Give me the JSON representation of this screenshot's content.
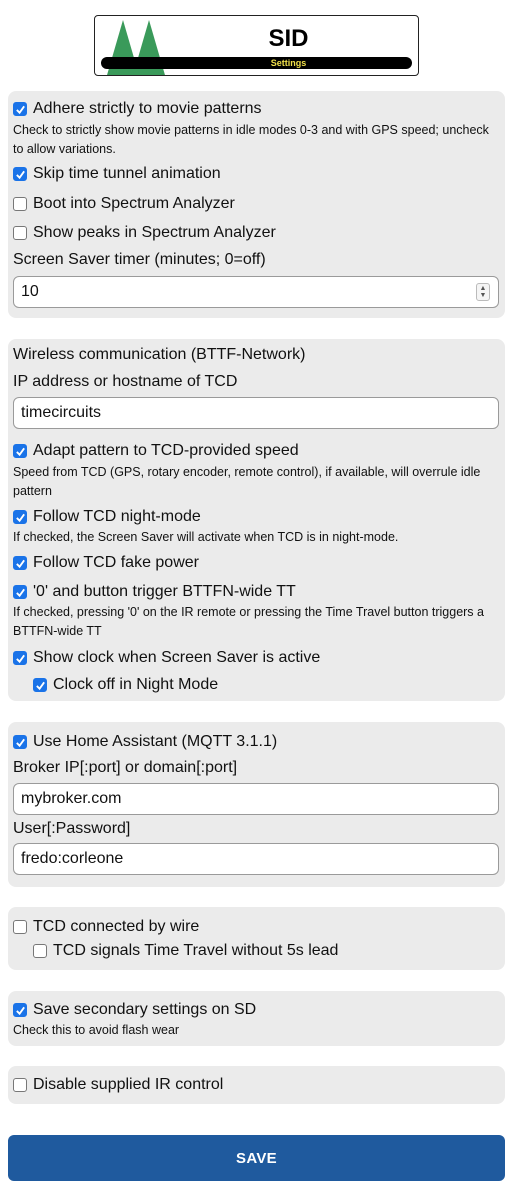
{
  "header": {
    "title": "SID",
    "subtitle": "Settings"
  },
  "general": {
    "adhere_label": "Adhere strictly to movie patterns",
    "adhere_help": "Check to strictly show movie patterns in idle modes 0-3 and with GPS speed; uncheck to allow variations.",
    "skip_tt_label": "Skip time tunnel animation",
    "boot_sa_label": "Boot into Spectrum Analyzer",
    "peaks_label": "Show peaks in Spectrum Analyzer",
    "ss_timer_label": "Screen Saver timer (minutes; 0=off)",
    "ss_timer_value": "10"
  },
  "bttfn": {
    "heading": "Wireless communication (BTTF-Network)",
    "tcd_ip_label": "IP address or hostname of TCD",
    "tcd_ip_value": "timecircuits",
    "adapt_label": "Adapt pattern to TCD-provided speed",
    "adapt_help": "Speed from TCD (GPS, rotary encoder, remote control), if available, will overrule idle pattern",
    "follow_nm_label": "Follow TCD night-mode",
    "follow_nm_help": "If checked, the Screen Saver will activate when TCD is in night-mode.",
    "follow_fp_label": "Follow TCD fake power",
    "trigger_label": "'0' and button trigger BTTFN-wide TT",
    "trigger_help": "If checked, pressing '0' on the IR remote or pressing the Time Travel button triggers a BTTFN-wide TT",
    "clock_ss_label": "Show clock when Screen Saver is active",
    "clock_nm_label": "Clock off in Night Mode"
  },
  "mqtt": {
    "use_ha_label": "Use Home Assistant (MQTT 3.1.1)",
    "broker_label": "Broker IP[:port] or domain[:port]",
    "broker_value": "mybroker.com",
    "user_label": "User[:Password]",
    "user_value": "fredo:corleone"
  },
  "wire": {
    "connected_label": "TCD connected by wire",
    "no_lead_label": "TCD signals Time Travel without 5s lead"
  },
  "sd": {
    "save_sd_label": "Save secondary settings on SD",
    "save_sd_help": "Check this to avoid flash wear"
  },
  "ir": {
    "disable_ir_label": "Disable supplied IR control"
  },
  "save_label": "SAVE",
  "colors": {
    "checkbox": "#1a73e8",
    "save_button": "#1f5a9e",
    "section_bg": "#ebebeb",
    "tree": "#3a9a5a"
  },
  "checkbox_states": {
    "adhere": true,
    "skip_tt": true,
    "boot_sa": false,
    "peaks": false,
    "adapt": true,
    "follow_nm": true,
    "follow_fp": true,
    "trigger": true,
    "clock_ss": true,
    "clock_nm": true,
    "use_ha": true,
    "wire_connected": false,
    "wire_no_lead": false,
    "save_sd": true,
    "disable_ir": false
  }
}
